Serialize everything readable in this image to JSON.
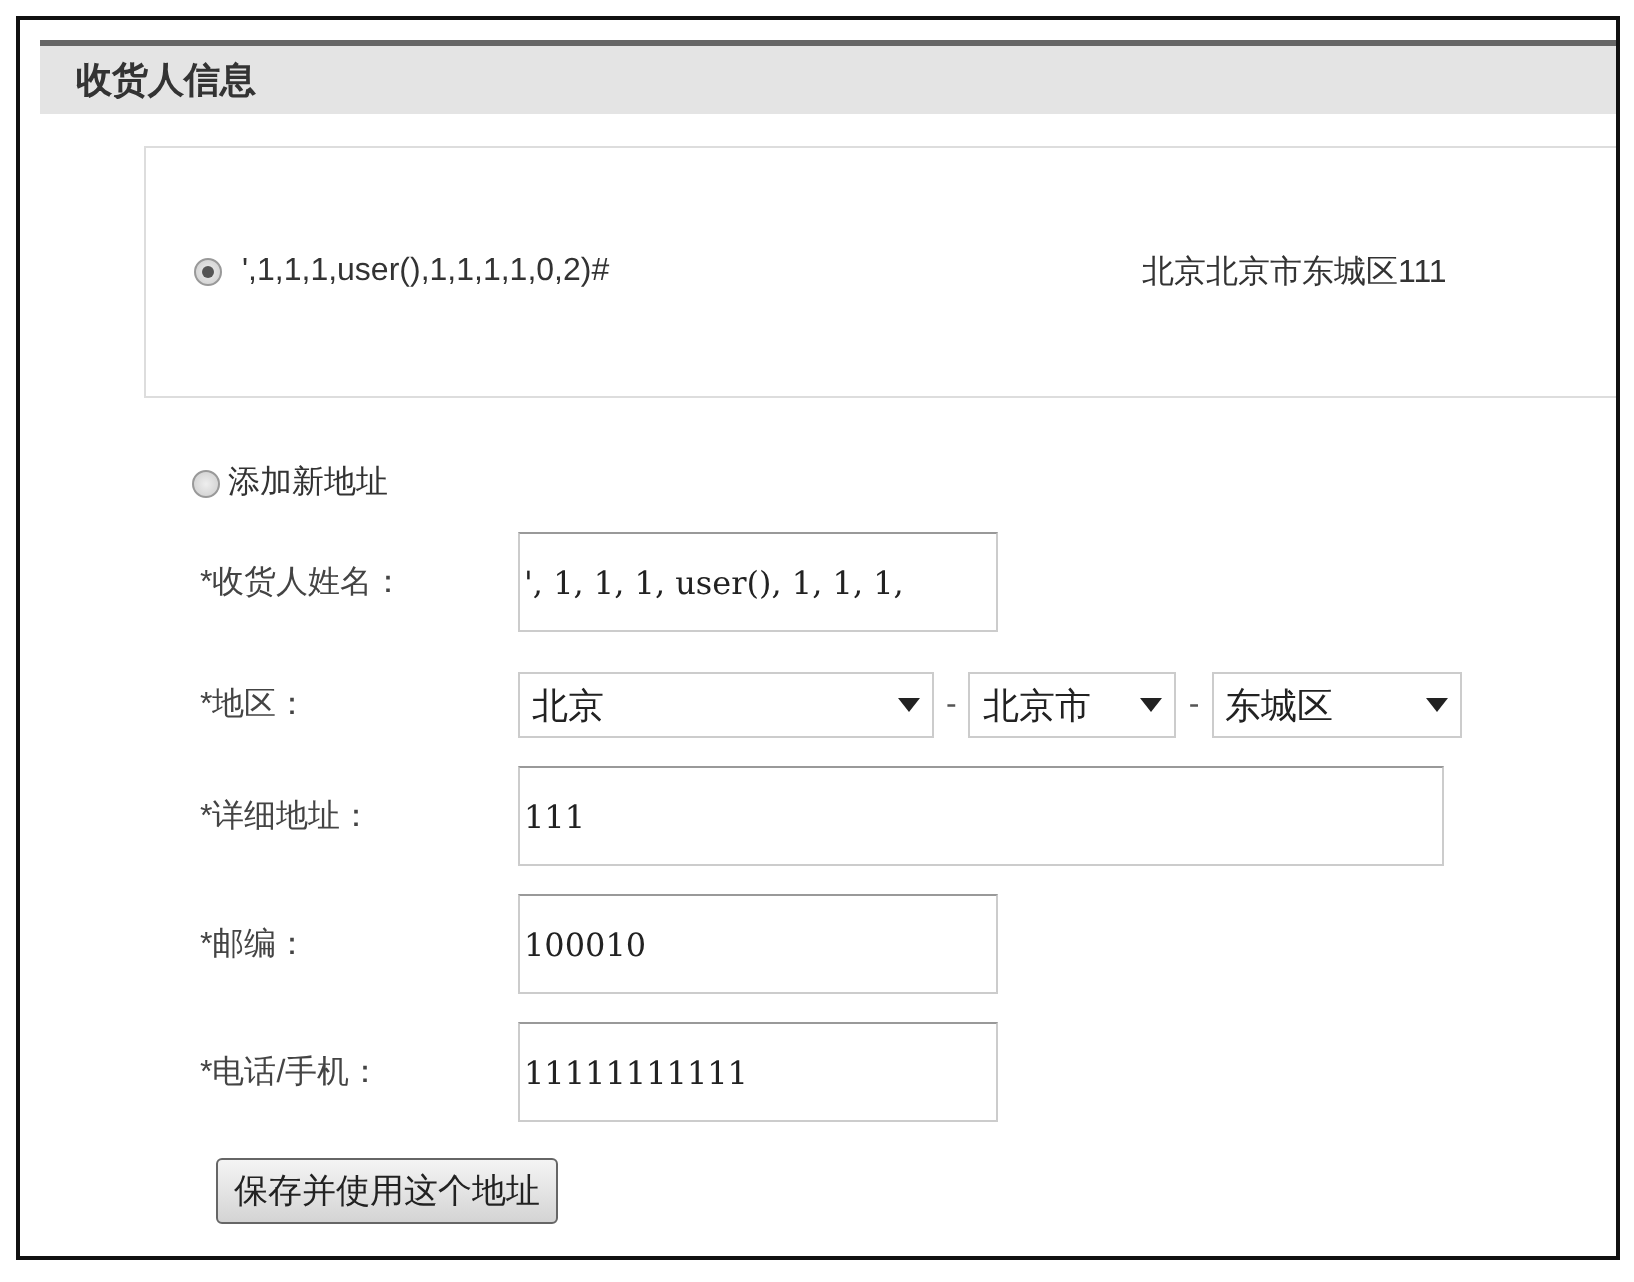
{
  "section": {
    "title": "收货人信息"
  },
  "saved_addresses": [
    {
      "selected": true,
      "name": "',1,1,1,user(),1,1,1,1,0,2)#",
      "address": "北京北京市东城区111"
    }
  ],
  "new_address": {
    "label": "添加新地址",
    "selected": false
  },
  "fields": [
    {
      "kind": "text",
      "label": "*收货人姓名：",
      "value": "', 1, 1, 1, user(), 1, 1, 1,",
      "wide": false
    },
    {
      "kind": "region",
      "label": "*地区：",
      "selects": [
        {
          "value": "北京"
        },
        {
          "value": "北京市"
        },
        {
          "value": "东城区"
        }
      ],
      "separators": [
        "-",
        "-"
      ]
    },
    {
      "kind": "text",
      "label": "*详细地址：",
      "value": "111",
      "wide": true
    },
    {
      "kind": "text",
      "label": "*邮编：",
      "value": "100010",
      "wide": false
    },
    {
      "kind": "text",
      "label": "*电话/手机：",
      "value": "11111111111",
      "wide": false
    }
  ],
  "save_button": {
    "label": "保存并使用这个地址"
  }
}
